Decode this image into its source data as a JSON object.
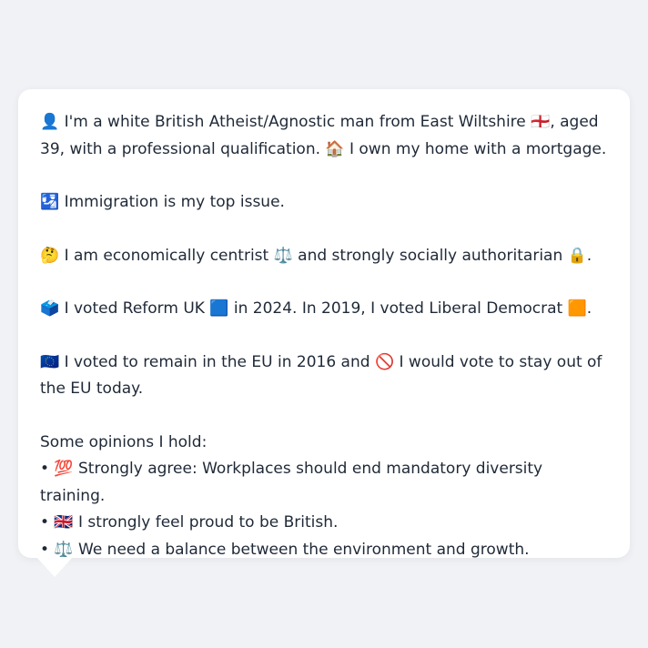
{
  "profile": {
    "intro": "👤 I'm a white British Atheist/Agnostic man from East Wiltshire 🏴󠁧󠁢󠁥󠁮󠁧󠁿, aged 39, with a professional qualification. 🏠 I own my home with a mortgage.",
    "top_issue": "🛂 Immigration is my top issue.",
    "ideology": "🤔 I am economically centrist ⚖️ and strongly socially authoritarian 🔒.",
    "votes": "🗳️ I voted Reform UK 🟦 in 2024. In 2019, I voted Liberal Democrat 🟧.",
    "eu": "🇪🇺 I voted to remain in the EU in 2016 and 🚫 I would vote to stay out of the EU today."
  },
  "opinions": {
    "heading": "Some opinions I hold:",
    "items": [
      "• 💯 Strongly agree: Workplaces should end mandatory diversity training.",
      "• 🇬🇧 I strongly feel proud to be British.",
      "• ⚖️ We need a balance between the environment and growth."
    ]
  }
}
